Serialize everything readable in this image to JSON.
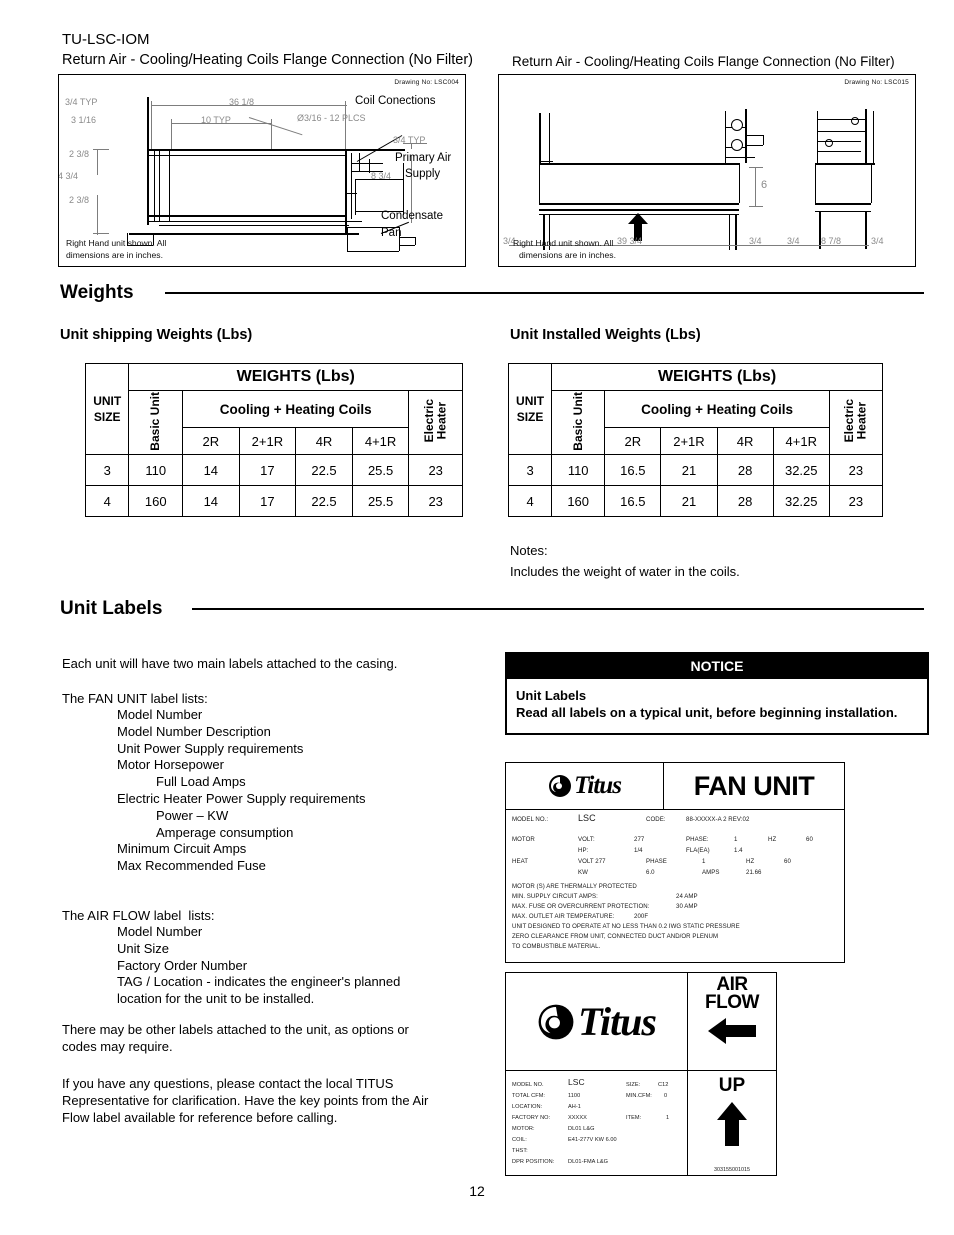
{
  "document": {
    "code": "TU-LSC-IOM",
    "page_number": "12"
  },
  "drawings": [
    {
      "caption": "Return Air - Cooling/Heating Coils Flange Connection (No Filter)",
      "drawing_no": "Drawing No: LSC004",
      "note_line1": "Right Hand unit shown. All",
      "note_line2": "dimensions are in inches.",
      "dimensions": {
        "d1": "3/4 TYP",
        "d2": "36 1/8",
        "d3": "3 1/16",
        "d4": "10 TYP",
        "d5": "Ø3/16 - 12 PLCS",
        "d6": "2 3/8",
        "d7": "4 3/4",
        "d8": "2 3/8",
        "d9": "3/4 TYP",
        "d10": "8 3/4"
      },
      "callouts": {
        "c1": "Coil Conections",
        "c2_line1": "Primary Air",
        "c2_line2": "Supply",
        "c3_line1": "Condensate",
        "c3_line2": "Pan"
      }
    },
    {
      "caption": "Return Air - Cooling/Heating Coils Flange Connection (No Filter)",
      "drawing_no": "Drawing No: LSC015",
      "note_line1": "Right Hand unit shown. All",
      "note_line2": "dimensions are in inches.",
      "dimensions": {
        "d1": "3/4",
        "d2": "39 3/4",
        "d3": "3/4",
        "d4": "6",
        "d5": "3/4",
        "d6": "8 7/8",
        "d7": "3/4"
      }
    }
  ],
  "weights_section": {
    "heading": "Weights",
    "shipping": {
      "subheading": "Unit shipping Weights (Lbs)",
      "table_title": "WEIGHTS (Lbs)",
      "col_unit_size": "UNIT\nSIZE",
      "col_basic_unit": "Basic Unit",
      "col_coils_group": "Cooling + Heating Coils",
      "col_electric_heater": "Electric\nHeater",
      "coil_columns": [
        "2R",
        "2+1R",
        "4R",
        "4+1R"
      ],
      "rows": [
        {
          "unit_size": "3",
          "basic_unit": "110",
          "coils": [
            "14",
            "17",
            "22.5",
            "25.5"
          ],
          "electric_heater": "23"
        },
        {
          "unit_size": "4",
          "basic_unit": "160",
          "coils": [
            "14",
            "17",
            "22.5",
            "25.5"
          ],
          "electric_heater": "23"
        }
      ]
    },
    "installed": {
      "subheading": "Unit Installed Weights (Lbs)",
      "table_title": "WEIGHTS (Lbs)",
      "col_unit_size": "UNIT\nSIZE",
      "col_basic_unit": "Basic Unit",
      "col_coils_group": "Cooling + Heating Coils",
      "col_electric_heater": "Electric\nHeater",
      "coil_columns": [
        "2R",
        "2+1R",
        "4R",
        "4+1R"
      ],
      "rows": [
        {
          "unit_size": "3",
          "basic_unit": "110",
          "coils": [
            "16.5",
            "21",
            "28",
            "32.25"
          ],
          "electric_heater": "23"
        },
        {
          "unit_size": "4",
          "basic_unit": "160",
          "coils": [
            "16.5",
            "21",
            "28",
            "32.25"
          ],
          "electric_heater": "23"
        }
      ],
      "notes_label": "Notes:",
      "notes_text": "Includes the weight of water in the coils."
    }
  },
  "unit_labels_section": {
    "heading": "Unit Labels",
    "intro": "Each unit will have two main labels attached to the casing.",
    "fan_unit_intro": "The FAN UNIT label lists:",
    "fan_unit_items": [
      {
        "text": "Model Number",
        "indent": 1
      },
      {
        "text": "Model Number Description",
        "indent": 1
      },
      {
        "text": "Unit Power Supply requirements",
        "indent": 1
      },
      {
        "text": "Motor Horsepower",
        "indent": 1
      },
      {
        "text": "Full Load Amps",
        "indent": 2
      },
      {
        "text": "Electric Heater Power Supply requirements",
        "indent": 1
      },
      {
        "text": "Power – KW",
        "indent": 2
      },
      {
        "text": "Amperage consumption",
        "indent": 2
      },
      {
        "text": "Minimum Circuit Amps",
        "indent": 1
      },
      {
        "text": "Max Recommended Fuse",
        "indent": 1
      }
    ],
    "air_flow_intro": "The AIR FLOW label  lists:",
    "air_flow_items": [
      {
        "text": "Model Number",
        "indent": 1
      },
      {
        "text": "Unit Size",
        "indent": 1
      },
      {
        "text": "Factory Order Number",
        "indent": 1
      },
      {
        "text": "TAG / Location - indicates the engineer's planned",
        "indent": 1
      },
      {
        "text": "location for the unit to be installed.",
        "indent": 1
      }
    ],
    "para_other": "There may be other labels attached to the unit, as options or\ncodes may require.",
    "para_questions": "If you have any questions, please contact the local TITUS\nRepresentative for clarification. Have the key points from the Air\nFlow label available for reference before calling."
  },
  "notice": {
    "bar_title": "NOTICE",
    "title": "Unit Labels",
    "body": "Read all labels on a typical unit, before beginning installation."
  },
  "fan_unit_label": {
    "brand": "Titus",
    "title": "FAN UNIT",
    "fields": {
      "model_no_label": "MODEL NO.:",
      "model_no_value": "LSC",
      "code_label": "CODE:",
      "code_value": "88-XXXXX-A 2 REV:02",
      "motor_label": "MOTOR",
      "motor_volt_label": "VOLT:",
      "motor_volt_value": "277",
      "motor_phase_label": "PHASE:",
      "motor_phase_value": "1",
      "motor_hz_label": "HZ",
      "motor_hz_value": "60",
      "motor_hp_label": "HP:",
      "motor_hp_value": "1/4",
      "motor_fla_label": "FLA(EA)",
      "motor_fla_value": "1.4",
      "heat_label": "HEAT",
      "heat_volt_label": "VOLT 277",
      "heat_phase_label": "PHASE",
      "heat_phase_value": "1",
      "heat_hz_label": "HZ",
      "heat_hz_value": "60",
      "heat_kw_label": "KW",
      "heat_kw_value": "6.0",
      "heat_amps_label": "AMPS",
      "heat_amps_value": "21.66"
    },
    "statements": [
      "MOTOR (S) ARE THERMALLY PROTECTED",
      "MIN. SUPPLY CIRCUIT AMPS:",
      "MAX. FUSE OR OVERCURRENT PROTECTION:",
      "MAX. OUTLET AIR TEMPERATURE:",
      "UNIT DESIGNED TO OPERATE AT NO LESS THAN 0.2 IWG STATIC PRESSURE",
      "ZERO CLEARANCE FROM UNIT, CONNECTED DUCT AND/OR PLENUM",
      "TO COMBUSTIBLE MATERIAL."
    ],
    "statement_values": {
      "min_supply_circuit_amps": "24 AMP",
      "max_fuse": "30 AMP",
      "max_outlet_air_temp": "200F"
    }
  },
  "air_flow_label": {
    "brand": "Titus",
    "title_line1": "AIR",
    "title_line2": "FLOW",
    "up_text": "UP",
    "serial": "303155001015",
    "fields": [
      {
        "label": "MODEL NO.",
        "value": "LSC"
      },
      {
        "label": "TOTAL CFM:",
        "value": "1100"
      },
      {
        "label": "LOCATION:",
        "value": "AH-1"
      },
      {
        "label": "FACTORY NO:",
        "value": "XXXXX"
      },
      {
        "label": "MOTOR:",
        "value": "DL01 L&G"
      },
      {
        "label": "COIL:",
        "value": "E41-277V KW 6.00"
      },
      {
        "label": "THST:",
        "value": ""
      },
      {
        "label": "DPR POSITION:",
        "value": "DL01-FMA L&G"
      }
    ],
    "right_fields": [
      {
        "label": "SIZE:",
        "value": "C12"
      },
      {
        "label": "MIN.CFM:",
        "value": "0"
      },
      {
        "label": "ITEM:",
        "value": "1"
      }
    ]
  }
}
